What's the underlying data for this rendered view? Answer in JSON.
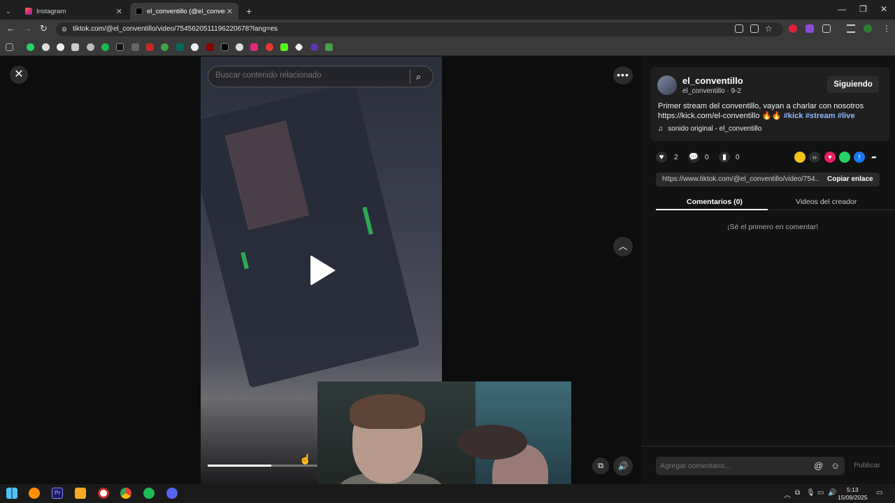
{
  "browser": {
    "tabs": [
      {
        "title": "Instagram",
        "active": false
      },
      {
        "title": "el_conventillo (@el_conventillo",
        "active": true
      }
    ],
    "url": "tiktok.com/@el_conventillo/video/7545620511196220678?lang=es",
    "window_controls": {
      "minimize": "—",
      "restore": "❐",
      "close": "✕"
    }
  },
  "player": {
    "search_placeholder": "Buscar contenido relacionado",
    "progress": 0.57
  },
  "creator": {
    "name": "el_conventillo",
    "handle": "el_conventillo · 9-2",
    "follow_label": "Siguiendo",
    "caption_text": "Primer stream del conventillo, vayan a charlar con nosotros https://kick.com/el-conventillo 🔥🔥",
    "hashtags": [
      "#kick",
      "#stream",
      "#live"
    ],
    "music": "sonido original - el_conventillo"
  },
  "actions": {
    "likes": "2",
    "comments": "0",
    "saves": "0"
  },
  "share": {
    "link": "https://www.tiktok.com/@el_conventillo/video/754...",
    "copy_label": "Copiar enlace"
  },
  "tabs": {
    "comments": "Comentarios (0)",
    "creator_videos": "Videos del creador"
  },
  "comments": {
    "empty_text": "¡Sé el primero en comentar!",
    "input_placeholder": "Agregar comentario...",
    "publish_label": "Publicar"
  },
  "taskbar": {
    "time": "5:13",
    "date": "15/09/2025"
  },
  "colors": {
    "accent_tag": "#8fb8ff",
    "spotify": "#1db954",
    "discord": "#5865f2",
    "chrome": "#e94235"
  }
}
